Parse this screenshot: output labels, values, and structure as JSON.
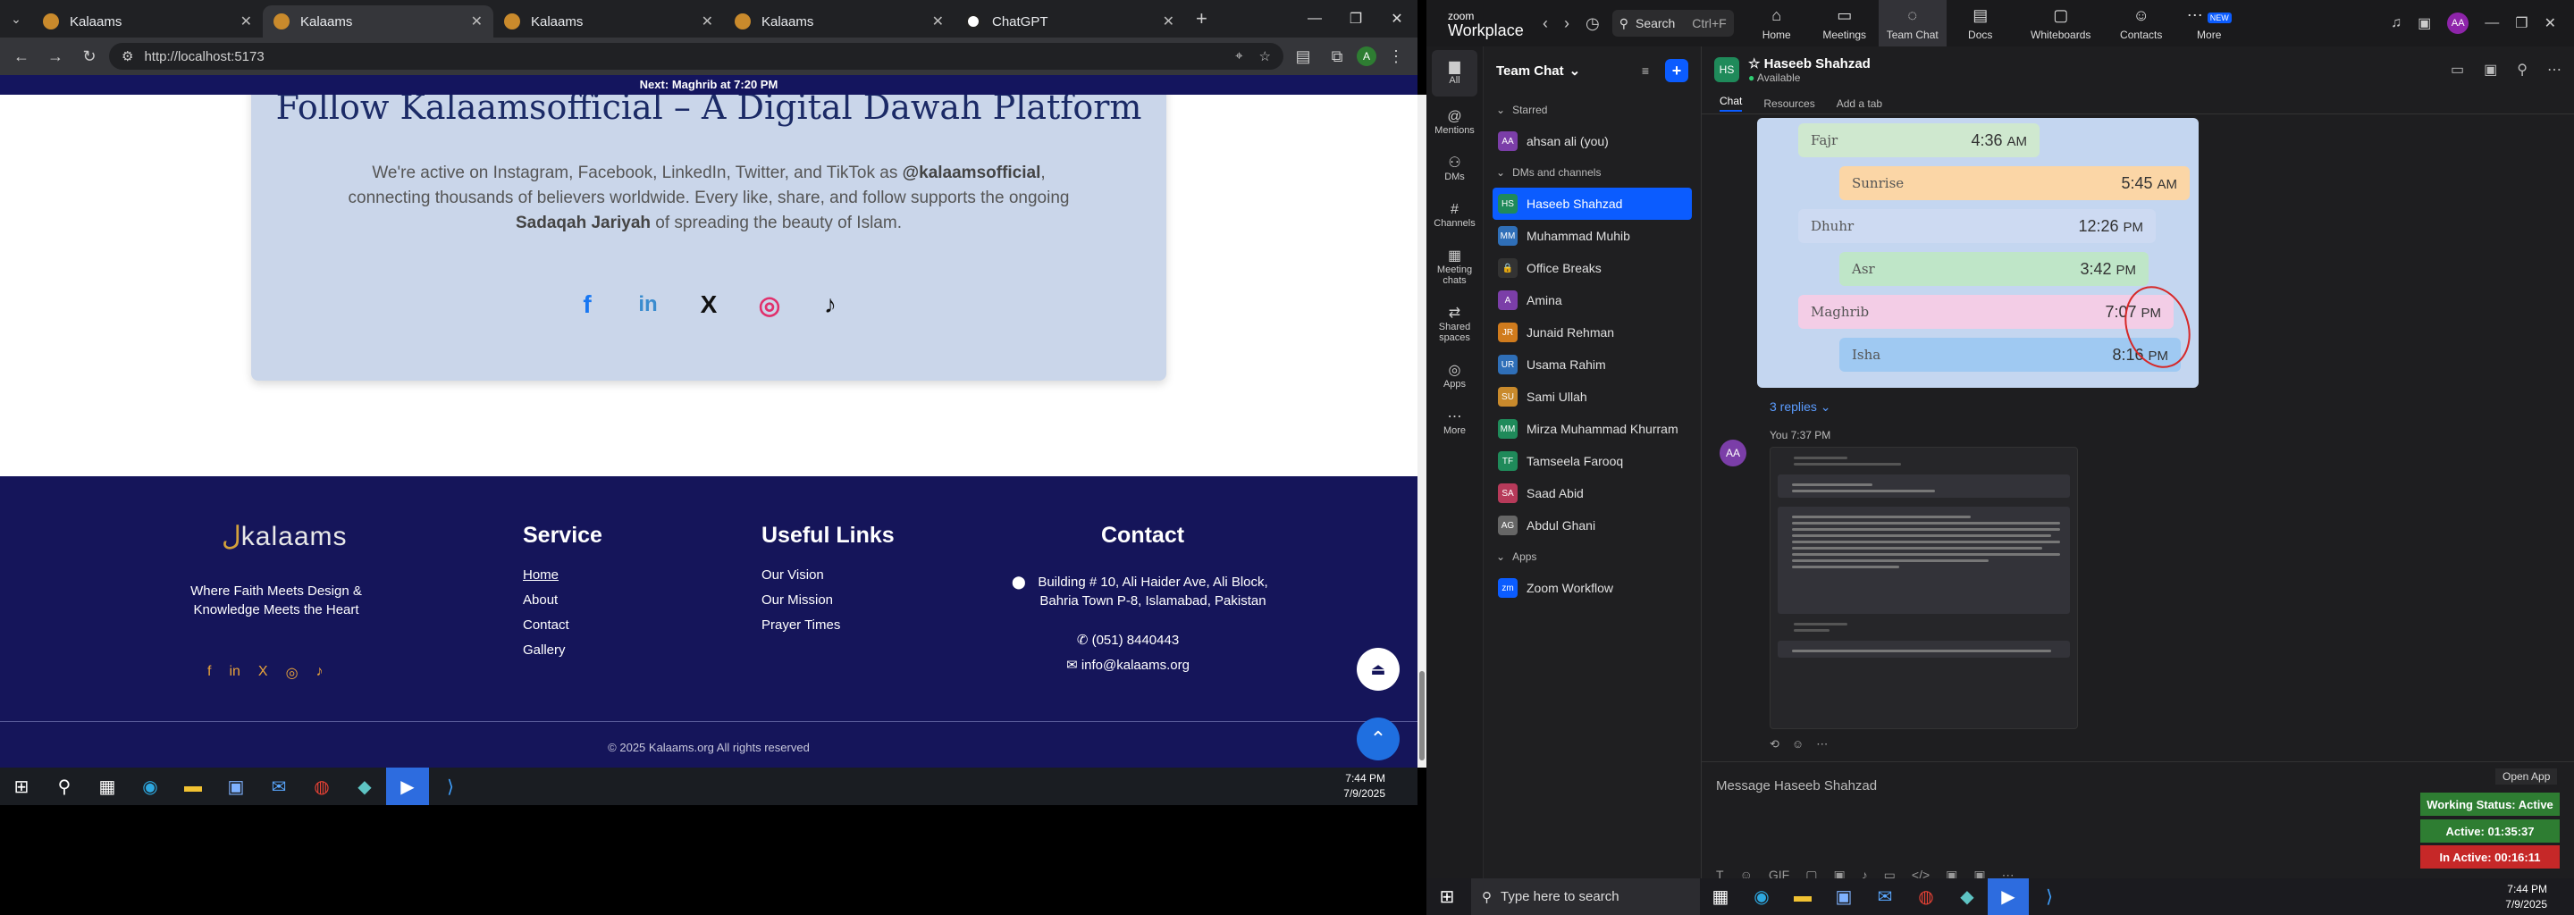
{
  "browser": {
    "tabs": [
      {
        "label": "Kalaams",
        "active": false
      },
      {
        "label": "Kalaams",
        "active": true
      },
      {
        "label": "Kalaams",
        "active": false
      },
      {
        "label": "Kalaams",
        "active": false
      },
      {
        "label": "ChatGPT",
        "active": false
      }
    ],
    "url": "http://localhost:5173"
  },
  "banner": {
    "prefix": "Next:",
    "prayer": "Maghrib",
    "suffix": "at 7:20 PM"
  },
  "follow": {
    "title": "Follow Kalaamsofficial – A Digital Dawah Platform",
    "text_a": "We're active on Instagram, Facebook, LinkedIn, Twitter, and TikTok as ",
    "handle": "@kalaamsofficial",
    "text_b": ", connecting thousands of believers worldwide. Every like, share, and follow supports the ongoing ",
    "sadaqah": "Sadaqah Jariyah",
    "text_c": " of spreading the beauty of Islam.",
    "icons": [
      "f",
      "in",
      "X",
      "◎",
      "♪"
    ]
  },
  "footer": {
    "logo_mark": "ل",
    "logo_text": "kalaams",
    "tagline": "Where Faith Meets Design & Knowledge Meets the Heart",
    "social": [
      "f",
      "in",
      "X",
      "◎",
      "♪"
    ],
    "service_title": "Service",
    "service": [
      "Home",
      "About",
      "Contact",
      "Gallery"
    ],
    "links_title": "Useful Links",
    "links": [
      "Our Vision",
      "Our Mission",
      "Prayer Times"
    ],
    "contact_title": "Contact",
    "address": "Building # 10, Ali Haider Ave, Ali Block, Bahria Town P-8, Islamabad, Pakistan",
    "phone": "(051) 8440443",
    "email": "info@kalaams.org",
    "copyright": "© 2025 Kalaams.org All rights reserved"
  },
  "taskbar_left": {
    "time": "7:44 PM",
    "date": "7/9/2025"
  },
  "zoom": {
    "brand_top": "zoom",
    "brand": "Workplace",
    "search": "Search",
    "search_kbd": "Ctrl+F",
    "tabs": [
      "Home",
      "Meetings",
      "Team Chat",
      "Docs",
      "Whiteboards",
      "Contacts",
      "More"
    ],
    "more_badge": "NEW",
    "avatar": "AA",
    "rail": [
      "All",
      "Mentions",
      "DMs",
      "Channels",
      "Meeting chats",
      "Shared spaces",
      "Apps",
      "More"
    ],
    "list_title": "Team Chat",
    "starred_label": "Starred",
    "starred": [
      {
        "init": "AA",
        "name": "ahsan ali (you)",
        "color": "#7b3ea8"
      }
    ],
    "dms_label": "DMs and channels",
    "dms": [
      {
        "init": "HS",
        "name": "Haseeb Shahzad",
        "color": "#1f8a5a"
      },
      {
        "init": "MM",
        "name": "Muhammad Muhib",
        "color": "#2f6fb8"
      },
      {
        "init": "🔒",
        "name": "Office Breaks",
        "color": "#333"
      },
      {
        "init": "A",
        "name": "Amina",
        "color": "#7b3ea8"
      },
      {
        "init": "JR",
        "name": "Junaid Rehman",
        "color": "#d07b1d"
      },
      {
        "init": "UR",
        "name": "Usama Rahim",
        "color": "#2f6fb8"
      },
      {
        "init": "SU",
        "name": "Sami Ullah",
        "color": "#c98a2c"
      },
      {
        "init": "MM",
        "name": "Mirza Muhammad Khurram",
        "color": "#1f8a5a"
      },
      {
        "init": "TF",
        "name": "Tamseela Farooq",
        "color": "#1f8a5a"
      },
      {
        "init": "SA",
        "name": "Saad Abid",
        "color": "#b73a5a"
      },
      {
        "init": "AG",
        "name": "Abdul Ghani",
        "color": "#666"
      }
    ],
    "apps_label": "Apps",
    "apps": [
      {
        "init": "zm",
        "name": "Zoom Workflow",
        "color": "#0b5cff"
      }
    ],
    "chat_name": "Haseeb Shahzad",
    "chat_status": "Available",
    "chat_tabs": [
      "Chat",
      "Resources",
      "Add a tab"
    ],
    "prayers": [
      {
        "name": "Fajr",
        "time": "4:36",
        "ampm": "AM"
      },
      {
        "name": "Sunrise",
        "time": "5:45",
        "ampm": "AM"
      },
      {
        "name": "Dhuhr",
        "time": "12:26",
        "ampm": "PM"
      },
      {
        "name": "Asr",
        "time": "3:42",
        "ampm": "PM"
      },
      {
        "name": "Maghrib",
        "time": "7:07",
        "ampm": "PM"
      },
      {
        "name": "Isha",
        "time": "8:16",
        "ampm": "PM"
      }
    ],
    "replies": "3 replies",
    "msg_meta": "You 7:37 PM",
    "compose_placeholder": "Message Haseeb Shahzad",
    "open_app": "Open App",
    "status": [
      {
        "label": "Working Status: Active",
        "color": "#2e7d32"
      },
      {
        "label": "Active: 01:35:37",
        "color": "#2e7d32"
      },
      {
        "label": "In Active: 00:16:11",
        "color": "#c62828"
      }
    ]
  },
  "taskbar_right": {
    "search": "Type here to search",
    "time": "7:44 PM",
    "date": "7/9/2025"
  }
}
